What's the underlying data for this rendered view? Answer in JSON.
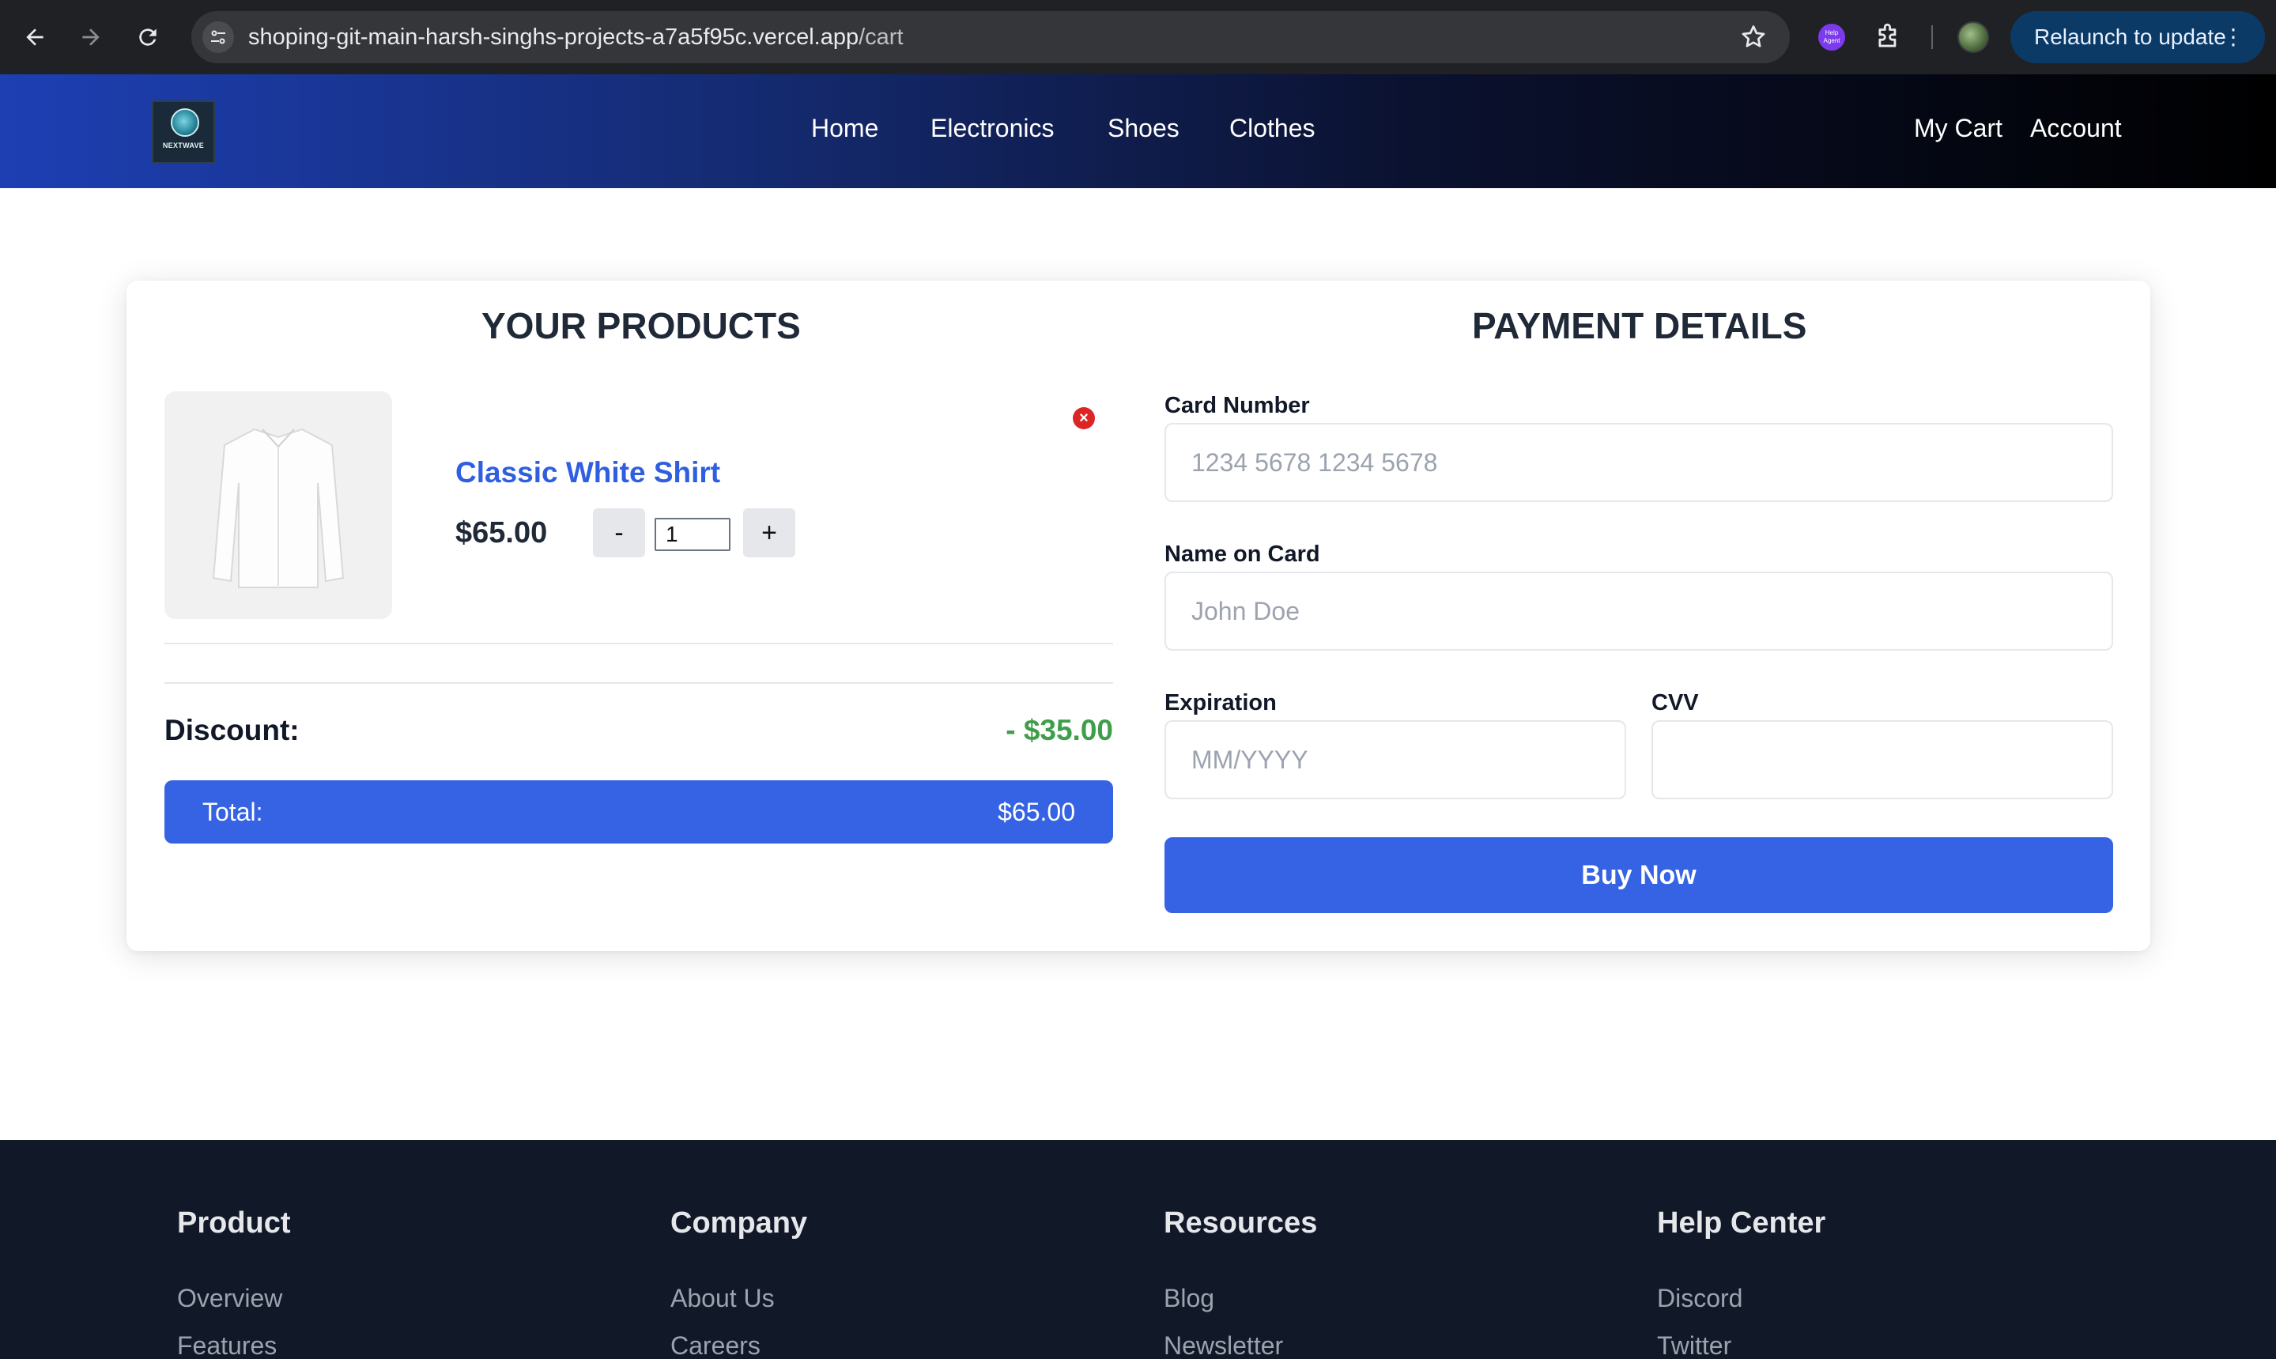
{
  "browser": {
    "url_host": "shoping-git-main-harsh-singhs-projects-a7a5f95c.vercel.app",
    "url_path": "/cart",
    "ai_extension_label": "Help Agent",
    "relaunch_label": "Relaunch to update"
  },
  "header": {
    "logo_text": "NEXTWAVE",
    "nav": [
      "Home",
      "Electronics",
      "Shoes",
      "Clothes"
    ],
    "cart_label": "My Cart",
    "account_label": "Account"
  },
  "products": {
    "title": "YOUR PRODUCTS",
    "items": [
      {
        "name": "Classic White Shirt",
        "price": "$65.00",
        "quantity": "1"
      }
    ],
    "decrement_label": "-",
    "increment_label": "+",
    "discount_label": "Discount:",
    "discount_value": "- $35.00",
    "total_label": "Total:",
    "total_value": "$65.00"
  },
  "payment": {
    "title": "PAYMENT DETAILS",
    "card_number_label": "Card Number",
    "card_number_placeholder": "1234 5678 1234 5678",
    "name_label": "Name on Card",
    "name_placeholder": "John Doe",
    "expiration_label": "Expiration",
    "expiration_placeholder": "MM/YYYY",
    "cvv_label": "CVV",
    "cvv_placeholder": "",
    "buy_label": "Buy Now"
  },
  "footer": {
    "columns": [
      {
        "heading": "Product",
        "links": [
          "Overview",
          "Features"
        ]
      },
      {
        "heading": "Company",
        "links": [
          "About Us",
          "Careers"
        ]
      },
      {
        "heading": "Resources",
        "links": [
          "Blog",
          "Newsletter"
        ]
      },
      {
        "heading": "Help Center",
        "links": [
          "Discord",
          "Twitter"
        ]
      }
    ]
  },
  "colors": {
    "accent": "#3563e4",
    "discount": "#3f9e4b",
    "remove": "#dc2626",
    "footer_bg": "#111827"
  }
}
